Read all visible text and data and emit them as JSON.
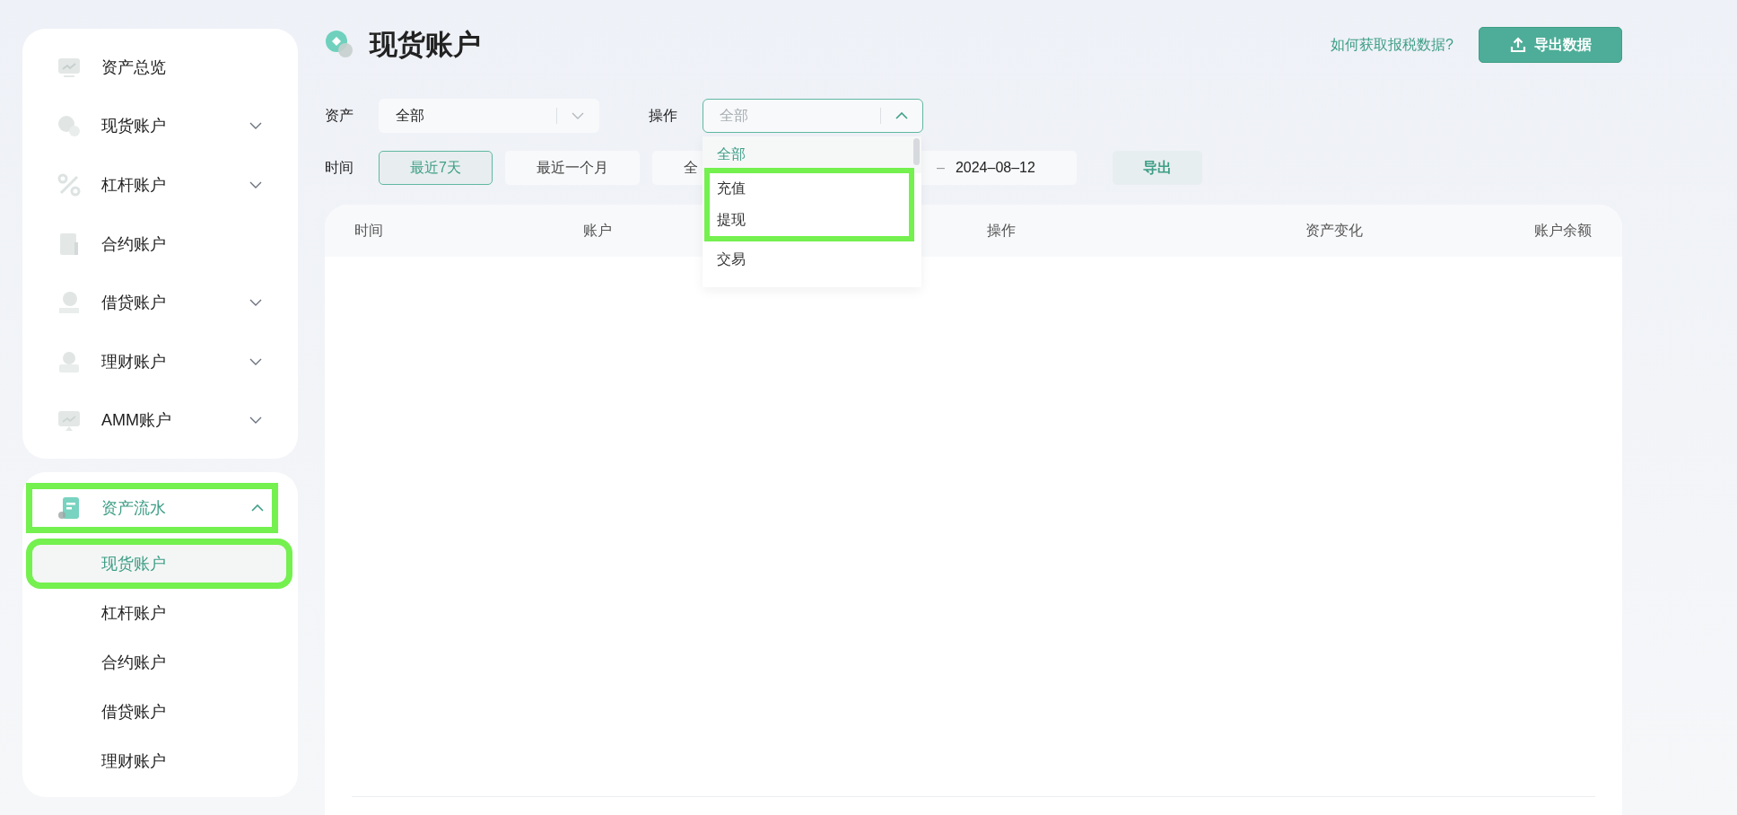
{
  "sidebar": {
    "main_items": [
      {
        "label": "资产总览",
        "kind": "link"
      },
      {
        "label": "现货账户",
        "kind": "group",
        "expanded": false
      },
      {
        "label": "杠杆账户",
        "kind": "group",
        "expanded": false
      },
      {
        "label": "合约账户",
        "kind": "link"
      },
      {
        "label": "借贷账户",
        "kind": "group",
        "expanded": false
      },
      {
        "label": "理财账户",
        "kind": "group",
        "expanded": false
      },
      {
        "label": "AMM账户",
        "kind": "group",
        "expanded": false
      }
    ],
    "history": {
      "label": "资产流水",
      "expanded": true,
      "highlighted": true,
      "children": [
        {
          "label": "现货账户",
          "selected": true,
          "highlighted": true
        },
        {
          "label": "杠杆账户",
          "selected": false,
          "highlighted": false
        },
        {
          "label": "合约账户",
          "selected": false,
          "highlighted": false
        },
        {
          "label": "借贷账户",
          "selected": false,
          "highlighted": false
        },
        {
          "label": "理财账户",
          "selected": false,
          "highlighted": false
        }
      ]
    }
  },
  "page": {
    "title": "现货账户",
    "help_link": "如何获取报税数据?",
    "export_data_button": "导出数据"
  },
  "filters": {
    "asset": {
      "label": "资产",
      "value": "全部"
    },
    "operation": {
      "label": "操作",
      "placeholder": "全部",
      "expanded": true,
      "options": [
        {
          "label": "全部",
          "selected": true,
          "highlighted": false
        },
        {
          "label": "充值",
          "selected": false,
          "highlighted": true
        },
        {
          "label": "提现",
          "selected": false,
          "highlighted": true
        },
        {
          "label": "交易",
          "selected": false,
          "highlighted": false
        }
      ]
    },
    "time": {
      "label": "时间",
      "ranges": [
        {
          "label": "最近7天",
          "selected": true
        },
        {
          "label": "最近一个月",
          "selected": false
        },
        {
          "label": "全",
          "selected": false
        }
      ],
      "date_separator": "–",
      "end_date": "2024–08–12"
    },
    "export_button": "导出"
  },
  "table": {
    "columns": [
      "时间",
      "账户",
      "操作",
      "资产变化",
      "账户余额"
    ]
  }
}
